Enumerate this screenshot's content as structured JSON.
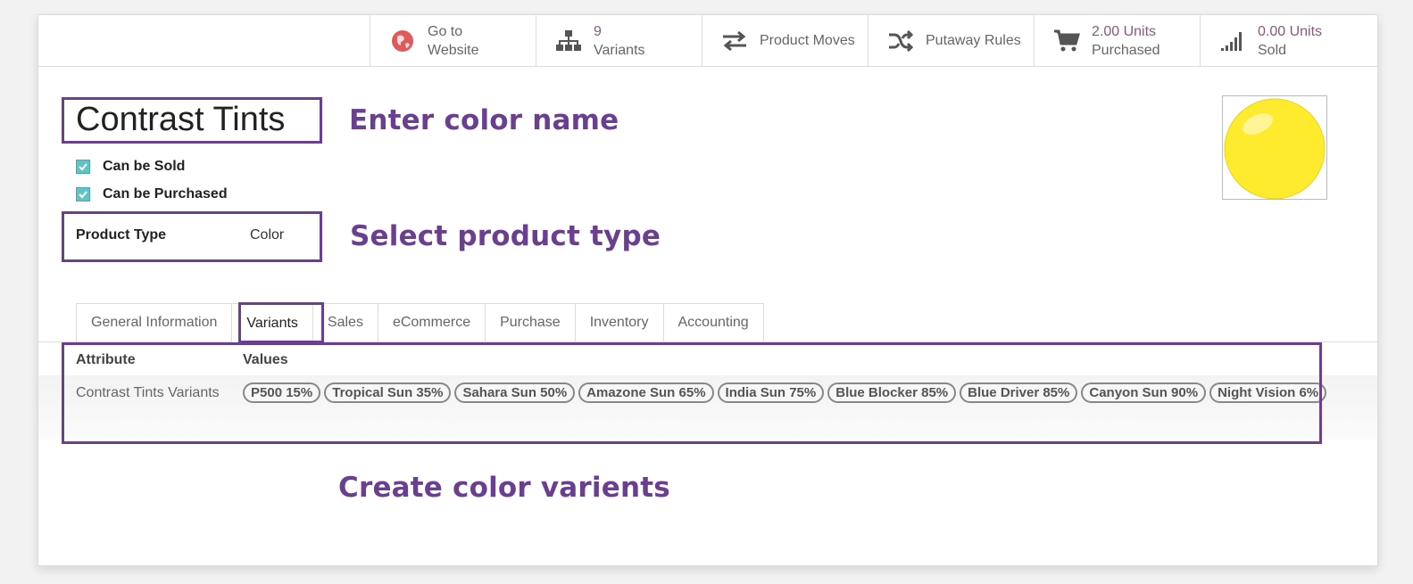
{
  "smart_buttons": {
    "website": {
      "line1": "Go to",
      "line2": "Website"
    },
    "variants": {
      "value": "9",
      "label": "Variants"
    },
    "moves": {
      "label": "Product Moves"
    },
    "putaway": {
      "label": "Putaway Rules"
    },
    "purchased": {
      "value": "2.00 Units",
      "label": "Purchased"
    },
    "sold": {
      "value": "0.00 Units",
      "label": "Sold"
    }
  },
  "product": {
    "name": "Contrast Tints",
    "can_be_sold_label": "Can be Sold",
    "can_be_purchased_label": "Can be Purchased",
    "type_label": "Product Type",
    "type_value": "Color"
  },
  "callouts": {
    "name": "Enter color name",
    "type": "Select product type",
    "variants": "Create color varients"
  },
  "tabs": [
    {
      "label": "General Information"
    },
    {
      "label": "Variants"
    },
    {
      "label": "Sales"
    },
    {
      "label": "eCommerce"
    },
    {
      "label": "Purchase"
    },
    {
      "label": "Inventory"
    },
    {
      "label": "Accounting"
    }
  ],
  "variants_table": {
    "headers": {
      "attribute": "Attribute",
      "values": "Values"
    },
    "rows": [
      {
        "attribute": "Contrast Tints Variants",
        "values": [
          "P500 15%",
          "Tropical Sun 35%",
          "Sahara Sun 50%",
          "Amazone Sun 65%",
          "India Sun 75%",
          "Blue Blocker 85%",
          "Blue Driver 85%",
          "Canyon Sun 90%",
          "Night Vision 6%"
        ]
      }
    ]
  },
  "colors": {
    "accent": "#6b3f8f",
    "stat_value": "#875A7B",
    "checkbox": "#62c3c6",
    "product_image": "#ffeb2e"
  },
  "icons": [
    "globe-icon",
    "sitemap-icon",
    "exchange-icon",
    "random-icon",
    "cart-icon",
    "signal-icon"
  ]
}
